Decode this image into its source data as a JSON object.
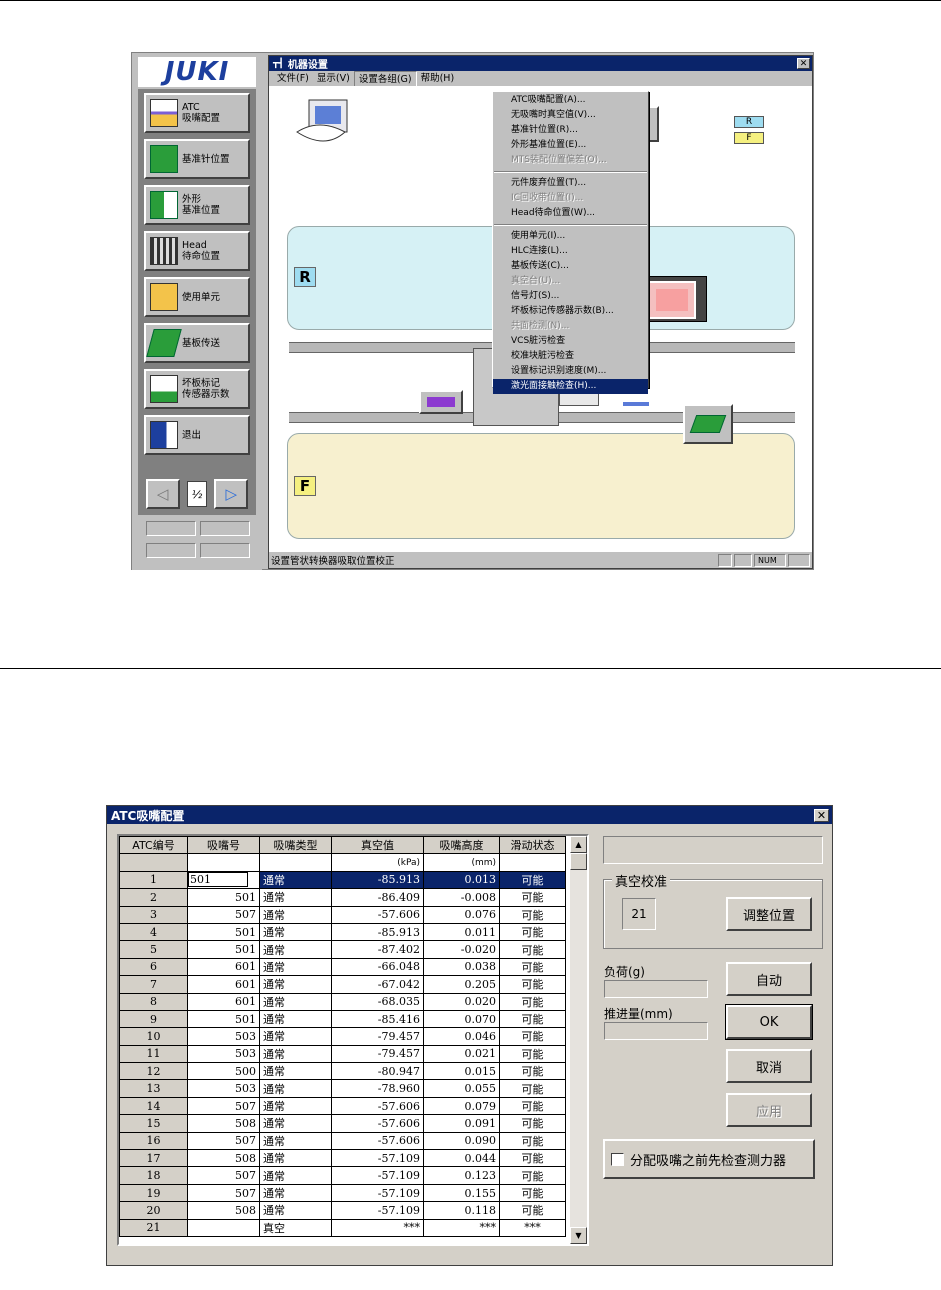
{
  "shot1": {
    "logo": "JUKI",
    "window_title": "机器设置",
    "menu": [
      "文件(F)",
      "显示(V)",
      "设置各组(G)",
      "帮助(H)"
    ],
    "sidebar": [
      {
        "label": "ATC\n吸嘴配置",
        "icon": "atc-nozzle-icon"
      },
      {
        "label": "基准针位置",
        "icon": "reference-pin-icon"
      },
      {
        "label": "外形\n基准位置",
        "icon": "outline-reference-icon"
      },
      {
        "label": "Head\n待命位置",
        "icon": "head-standby-icon"
      },
      {
        "label": "使用单元",
        "icon": "unit-usage-icon"
      },
      {
        "label": "基板传送",
        "icon": "board-transfer-icon"
      },
      {
        "label": "坏板标记\n传感器示数",
        "icon": "bad-mark-sensor-icon"
      },
      {
        "label": "退出",
        "icon": "exit-door-icon"
      }
    ],
    "pager": {
      "page": "½",
      "prev": "◁",
      "next": "▷"
    },
    "dropdown": [
      {
        "label": "ATC吸嘴配置(A)...",
        "state": "normal"
      },
      {
        "label": "无吸嘴时真空值(V)...",
        "state": "normal"
      },
      {
        "label": "基准针位置(R)...",
        "state": "normal"
      },
      {
        "label": "外形基准位置(E)...",
        "state": "normal"
      },
      {
        "label": "MTS装配位置偏差(O)...",
        "state": "disabled"
      },
      {
        "sep": true
      },
      {
        "label": "元件废弃位置(T)...",
        "state": "normal"
      },
      {
        "label": "IC回收带位置(I)...",
        "state": "disabled"
      },
      {
        "label": "Head待命位置(W)...",
        "state": "normal"
      },
      {
        "sep": true
      },
      {
        "label": "使用单元(I)...",
        "state": "normal"
      },
      {
        "label": "HLC连接(L)...",
        "state": "normal"
      },
      {
        "label": "基板传送(C)...",
        "state": "normal"
      },
      {
        "label": "真空台(U)...",
        "state": "disabled"
      },
      {
        "label": "信号灯(S)...",
        "state": "normal"
      },
      {
        "label": "坏板标记传感器示数(B)...",
        "state": "normal"
      },
      {
        "label": "共面检测(N)...",
        "state": "disabled"
      },
      {
        "label": "VCS脏污检查",
        "state": "normal"
      },
      {
        "label": "校准块脏污检查",
        "state": "normal"
      },
      {
        "label": "设置标记识别速度(M)...",
        "state": "normal"
      },
      {
        "label": "激光面接触检查(H)...",
        "state": "selected"
      }
    ],
    "zone_r": "R",
    "zone_f": "F",
    "legend_r": "R",
    "legend_f": "F",
    "status_text": "设置管状转换器吸取位置校正",
    "status_num": "NUM",
    "colors": {
      "titlebar": "#0a246a",
      "zone_r": "#d6f1f5",
      "zone_f": "#f7f0cf",
      "legend_r": "#9edcf0",
      "legend_f": "#f5f080"
    }
  },
  "shot2": {
    "title": "ATC吸嘴配置",
    "columns": [
      "ATC编号",
      "吸嘴号",
      "吸嘴类型",
      "真空值",
      "吸嘴高度",
      "滑动状态"
    ],
    "units": [
      "",
      "",
      "",
      "(kPa)",
      "(mm)",
      ""
    ],
    "rows": [
      [
        "1",
        "501",
        "通常",
        "-85.913",
        "0.013",
        "可能"
      ],
      [
        "2",
        "501",
        "通常",
        "-86.409",
        "-0.008",
        "可能"
      ],
      [
        "3",
        "507",
        "通常",
        "-57.606",
        "0.076",
        "可能"
      ],
      [
        "4",
        "501",
        "通常",
        "-85.913",
        "0.011",
        "可能"
      ],
      [
        "5",
        "501",
        "通常",
        "-87.402",
        "-0.020",
        "可能"
      ],
      [
        "6",
        "601",
        "通常",
        "-66.048",
        "0.038",
        "可能"
      ],
      [
        "7",
        "601",
        "通常",
        "-67.042",
        "0.205",
        "可能"
      ],
      [
        "8",
        "601",
        "通常",
        "-68.035",
        "0.020",
        "可能"
      ],
      [
        "9",
        "501",
        "通常",
        "-85.416",
        "0.070",
        "可能"
      ],
      [
        "10",
        "503",
        "通常",
        "-79.457",
        "0.046",
        "可能"
      ],
      [
        "11",
        "503",
        "通常",
        "-79.457",
        "0.021",
        "可能"
      ],
      [
        "12",
        "500",
        "通常",
        "-80.947",
        "0.015",
        "可能"
      ],
      [
        "13",
        "503",
        "通常",
        "-78.960",
        "0.055",
        "可能"
      ],
      [
        "14",
        "507",
        "通常",
        "-57.606",
        "0.079",
        "可能"
      ],
      [
        "15",
        "508",
        "通常",
        "-57.606",
        "0.091",
        "可能"
      ],
      [
        "16",
        "507",
        "通常",
        "-57.606",
        "0.090",
        "可能"
      ],
      [
        "17",
        "508",
        "通常",
        "-57.109",
        "0.044",
        "可能"
      ],
      [
        "18",
        "507",
        "通常",
        "-57.109",
        "0.123",
        "可能"
      ],
      [
        "19",
        "507",
        "通常",
        "-57.109",
        "0.155",
        "可能"
      ],
      [
        "20",
        "508",
        "通常",
        "-57.109",
        "0.118",
        "可能"
      ],
      [
        "21",
        "",
        "真空",
        "***",
        "***",
        "***"
      ]
    ],
    "vacuum_group": "真空校准",
    "vacuum_value": "21",
    "adjust_button": "调整位置",
    "load_label": "负荷(g)",
    "push_label": "推进量(mm)",
    "auto_button": "自动",
    "ok_button": "OK",
    "cancel_button": "取消",
    "apply_button": "应用",
    "check_label": "分配吸嘴之前先检查测力器"
  }
}
